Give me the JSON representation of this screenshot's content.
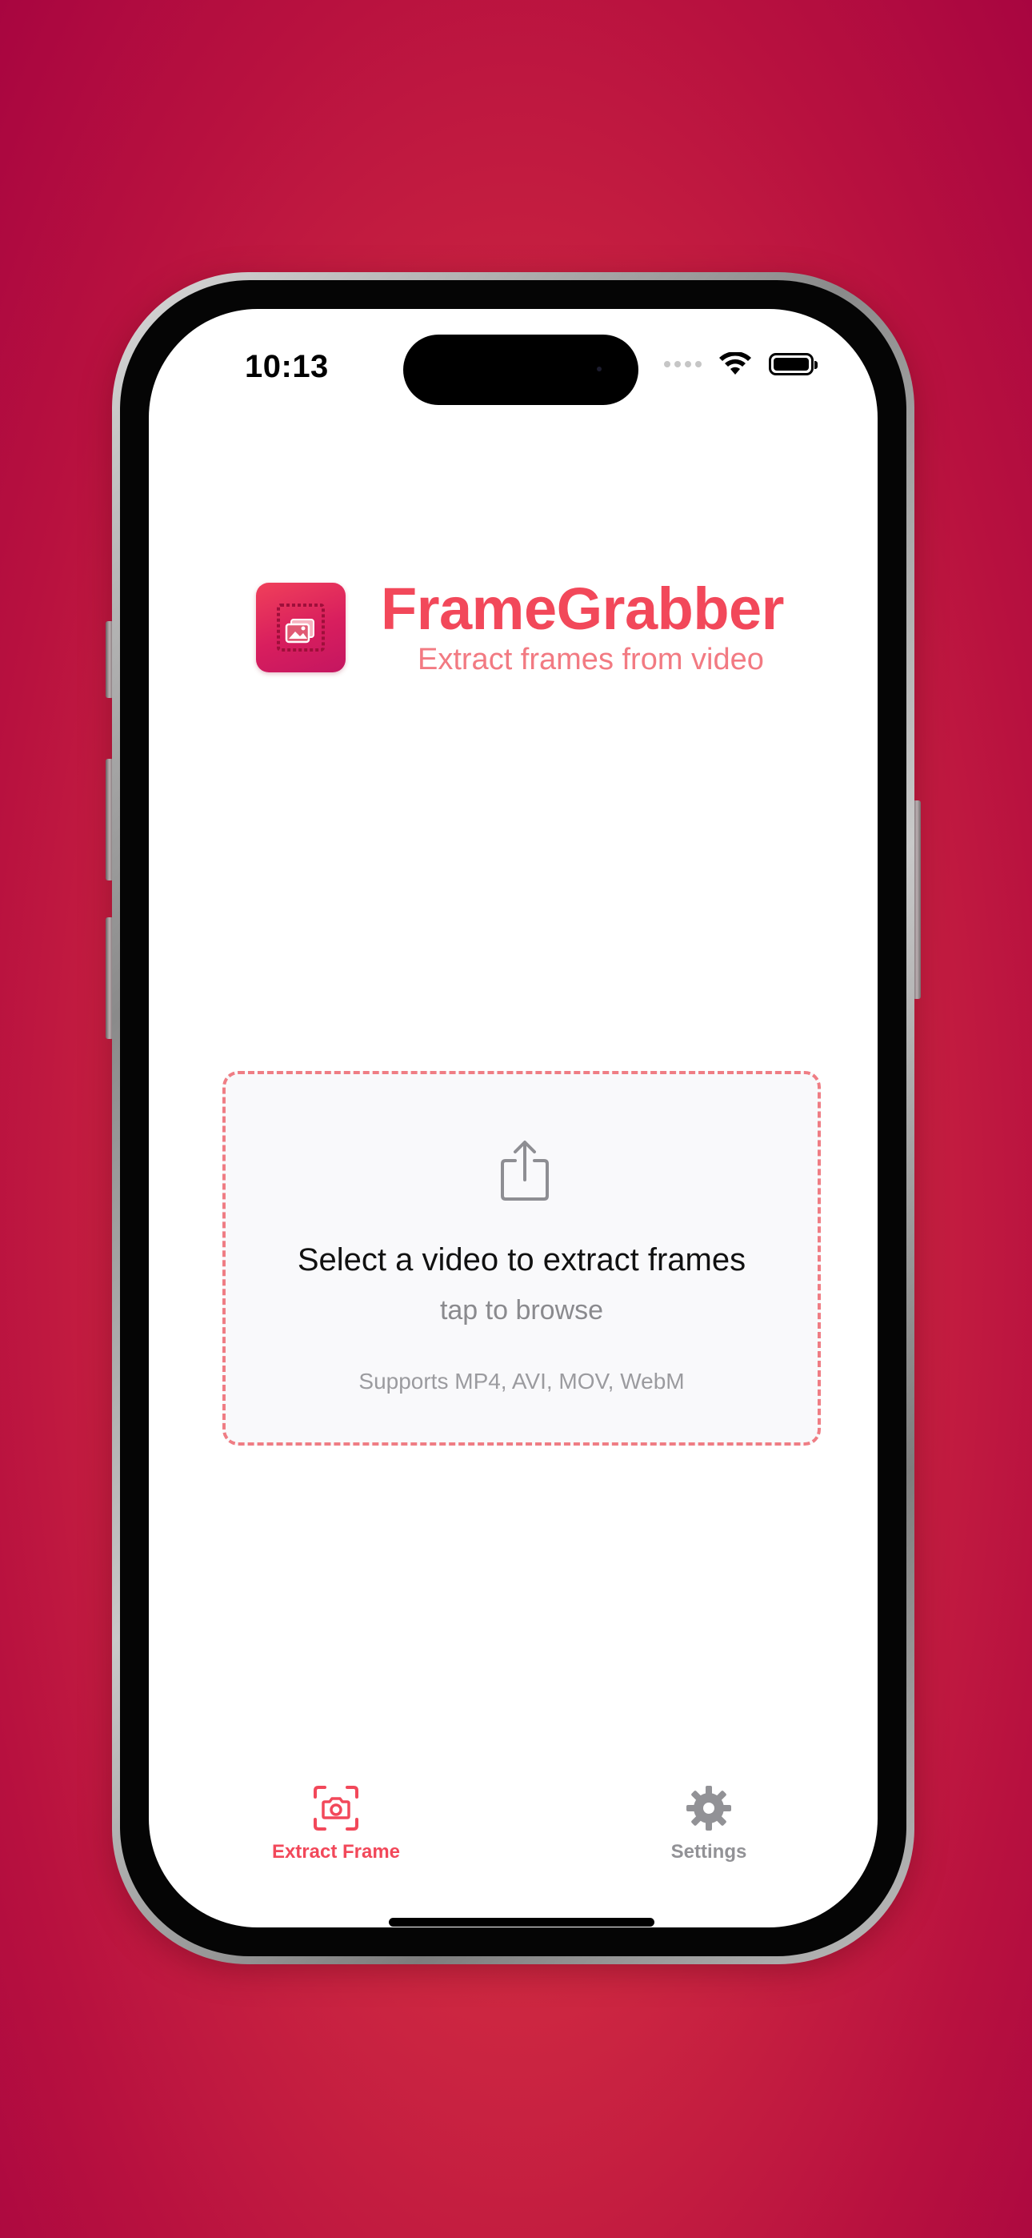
{
  "status_bar": {
    "time": "10:13"
  },
  "header": {
    "app_name": "FrameGrabber",
    "tagline": "Extract frames from video",
    "icon": "app-logo-icon"
  },
  "dropzone": {
    "icon": "share-upload-icon",
    "title": "Select a video to extract frames",
    "subtitle": "tap to browse",
    "supported": "Supports MP4, AVI, MOV, WebM"
  },
  "tabbar": {
    "items": [
      {
        "label": "Extract Frame",
        "icon": "camera-viewfinder-icon",
        "active": true
      },
      {
        "label": "Settings",
        "icon": "gear-icon",
        "active": false
      }
    ]
  },
  "colors": {
    "accent": "#f2485a",
    "background_outer": "#d32d42",
    "dropzone_border": "#ef7d84",
    "inactive_tab": "#929296"
  }
}
